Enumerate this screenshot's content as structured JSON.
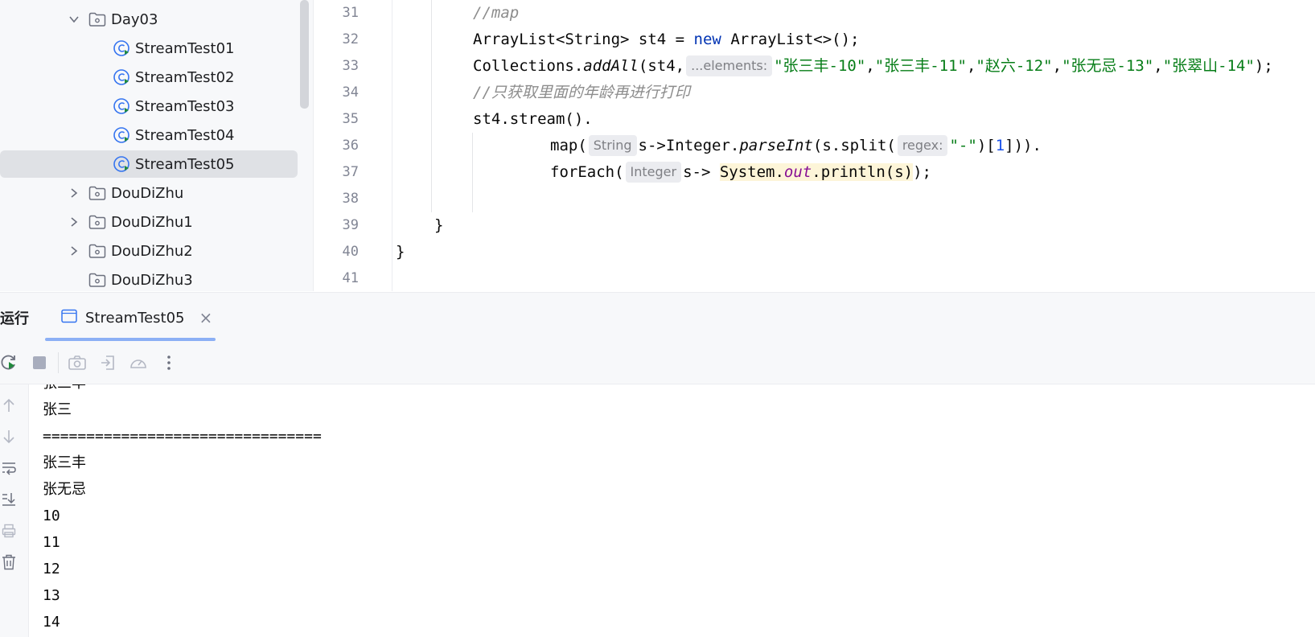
{
  "tree": {
    "items": [
      {
        "label": "Day03",
        "kind": "folder",
        "expanded": true
      },
      {
        "label": "StreamTest01",
        "kind": "class"
      },
      {
        "label": "StreamTest02",
        "kind": "class"
      },
      {
        "label": "StreamTest03",
        "kind": "class"
      },
      {
        "label": "StreamTest04",
        "kind": "class"
      },
      {
        "label": "StreamTest05",
        "kind": "class",
        "selected": true
      },
      {
        "label": "DouDiZhu",
        "kind": "folder",
        "expanded": false
      },
      {
        "label": "DouDiZhu1",
        "kind": "folder",
        "expanded": false
      },
      {
        "label": "DouDiZhu2",
        "kind": "folder",
        "expanded": false
      },
      {
        "label": "DouDiZhu3",
        "kind": "folder"
      }
    ]
  },
  "editor": {
    "line_numbers": [
      "31",
      "32",
      "33",
      "34",
      "35",
      "36",
      "37",
      "38",
      "39",
      "40",
      "41"
    ],
    "code": {
      "l31_comment": "//map",
      "l32_a": "ArrayList<String> st4 = ",
      "l32_kw": "new",
      "l32_b": " ArrayList<>();",
      "l33_a": "Collections.",
      "l33_method": "addAll",
      "l33_b": "(st4,",
      "l33_hint": "...elements:",
      "l33_s1": "\"张三丰-10\"",
      "l33_s2": "\"张三丰-11\"",
      "l33_s3": "\"赵六-12\"",
      "l33_s4": "\"张无忌-13\"",
      "l33_s5": "\"张翠山-14\"",
      "comma": ",",
      "l33_end": ");",
      "l34_comment": "//只获取里面的年龄再进行打印",
      "l35": "st4.stream().",
      "l36_a": "map(",
      "l36_hint1": "String",
      "l36_b": "s->Integer.",
      "l36_method": "parseInt",
      "l36_c": "(s.split(",
      "l36_hint2": "regex:",
      "l36_str": "\"-\"",
      "l36_d": ")[",
      "l36_num": "1",
      "l36_e": "])).",
      "l37_a": "forEach(",
      "l37_hint": "Integer",
      "l37_b": "s-> ",
      "l37_c": "System.",
      "l37_field": "out",
      "l37_d": ".println(s)",
      "l37_e": ");",
      "l39": "}",
      "l40": "}"
    }
  },
  "run": {
    "title": "运行",
    "tab_label": "StreamTest05",
    "close_glyph": "×",
    "output": [
      "张三丰",
      "张三",
      "================================",
      "张三丰",
      "张无忌",
      "10",
      "11",
      "12",
      "13",
      "14"
    ]
  },
  "colors": {
    "keyword": "#0033b3",
    "string": "#067d17",
    "number": "#1750eb",
    "comment": "#8c8c8c",
    "field": "#871094",
    "accent": "#3574f0"
  }
}
